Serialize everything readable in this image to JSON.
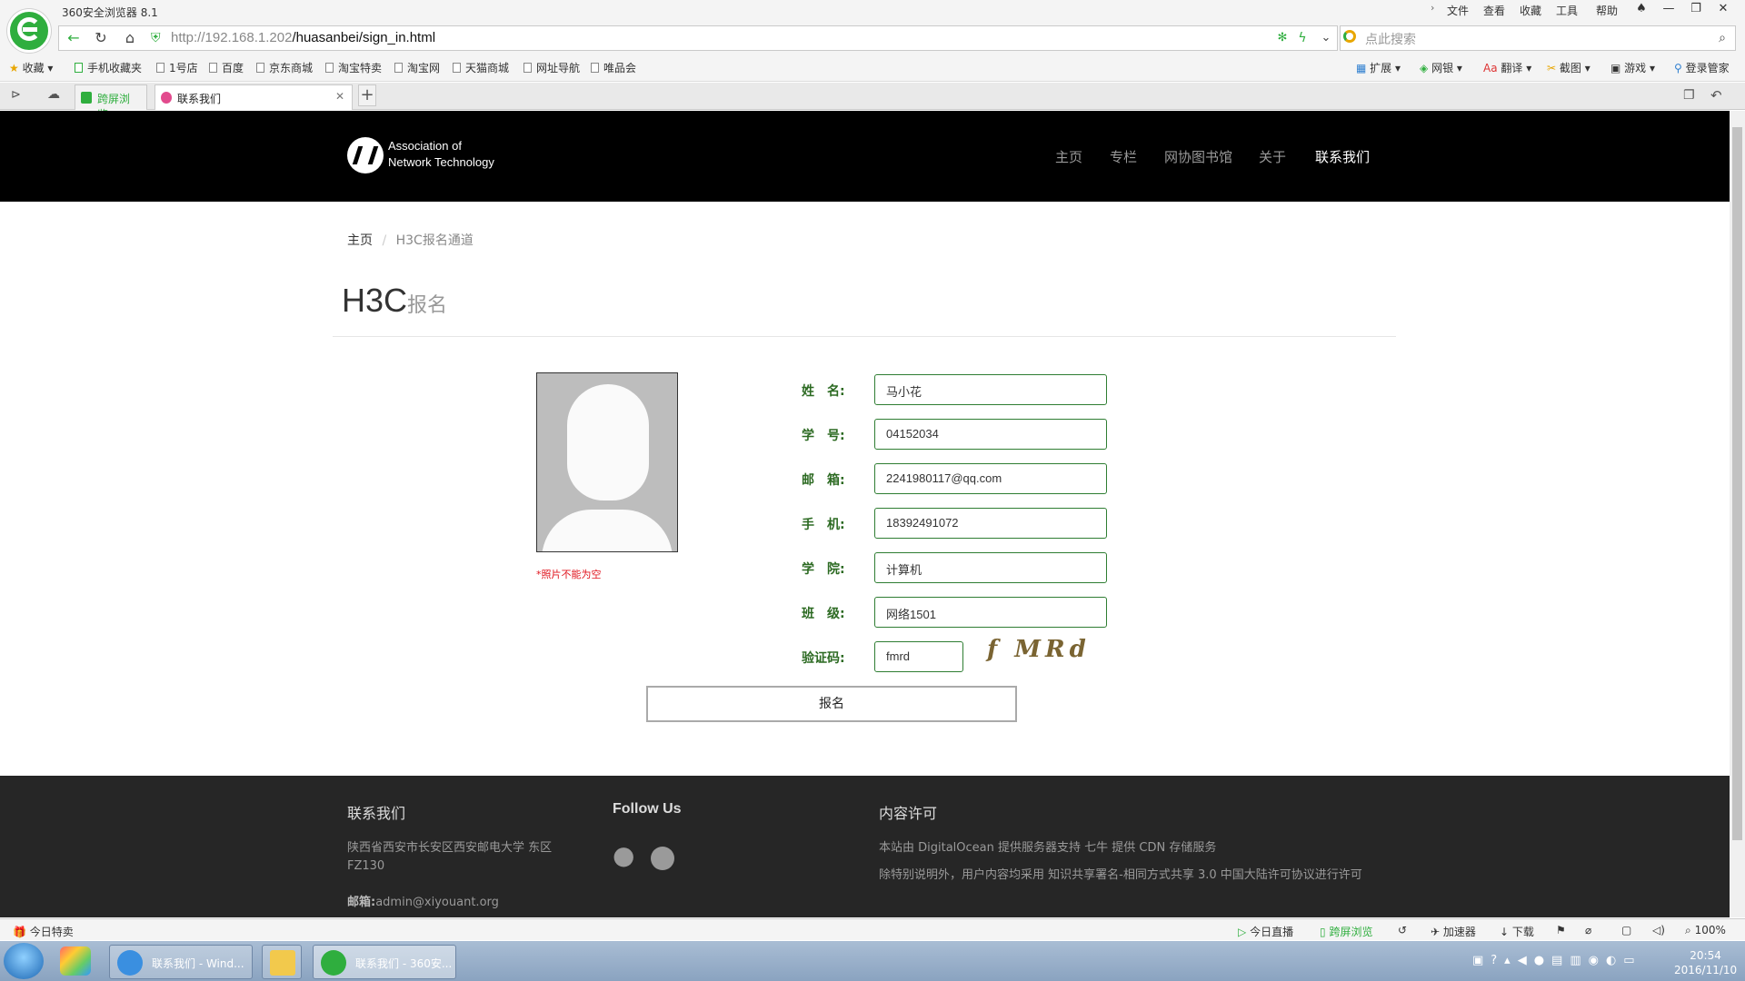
{
  "browser": {
    "app_title": "360安全浏览器 8.1",
    "menu": [
      "文件",
      "查看",
      "收藏",
      "工具",
      "帮助"
    ],
    "url_host": "http://192.168.1.202",
    "url_path": "/huasanbei/sign_in.html",
    "search_placeholder": "点此搜索",
    "bookmarks_label": "收藏",
    "bookmarks": [
      "手机收藏夹",
      "1号店",
      "百度",
      "京东商城",
      "淘宝特卖",
      "淘宝网",
      "天猫商城",
      "网址导航",
      "唯品会"
    ],
    "right_tools": [
      "扩展",
      "网银",
      "翻译",
      "截图",
      "游戏",
      "登录管家"
    ],
    "tabs": [
      {
        "label": "跨屏浏览",
        "active": false,
        "color": "#2fae3e"
      },
      {
        "label": "联系我们",
        "active": true,
        "color": "#e24a8d"
      }
    ],
    "new_tab": "+"
  },
  "site": {
    "name_line1": "Association of",
    "name_line2": "Network Technology",
    "nav": [
      "主页",
      "专栏",
      "网协图书馆",
      "关于",
      "联系我们"
    ],
    "nav_active": "联系我们",
    "breadcrumb_home": "主页",
    "breadcrumb_sep": "/",
    "breadcrumb_current": "H3C报名通道",
    "title_main": "H3C",
    "title_sub": "报名",
    "photo_error": "*照片不能为空",
    "form": {
      "name_label": "姓　名:",
      "name_value": "马小花",
      "id_label": "学　号:",
      "id_value": "04152034",
      "email_label": "邮　箱:",
      "email_value": "2241980117@qq.com",
      "phone_label": "手　机:",
      "phone_value": "18392491072",
      "college_label": "学　院:",
      "college_value": "计算机",
      "class_label": "班　级:",
      "class_value": "网络1501",
      "captcha_label": "验证码:",
      "captcha_value": "fmrd",
      "captcha_image_text": "f MRd",
      "submit_label": "报名"
    },
    "footer": {
      "contact_title": "联系我们",
      "contact_address": "陕西省西安市长安区西安邮电大学 东区 FZ130",
      "contact_email_label": "邮箱:",
      "contact_email": "admin@xiyouant.org",
      "follow_title": "Follow Us",
      "license_title": "内容许可",
      "license_line1": "本站由 DigitalOcean 提供服务器支持 七牛 提供 CDN 存储服务",
      "license_line2": "除特别说明外，用户内容均采用 知识共享署名-相同方式共享 3.0 中国大陆许可协议进行许可"
    }
  },
  "statusbar": {
    "left": "今日特卖",
    "items": [
      "今日直播",
      "跨屏浏览",
      "加速器",
      "下载"
    ],
    "zoom": "100%"
  },
  "taskbar": {
    "tasks": [
      "联系我们 - Wind...",
      "联系我们 - 360安..."
    ],
    "time": "20:54",
    "date": "2016/11/10"
  }
}
